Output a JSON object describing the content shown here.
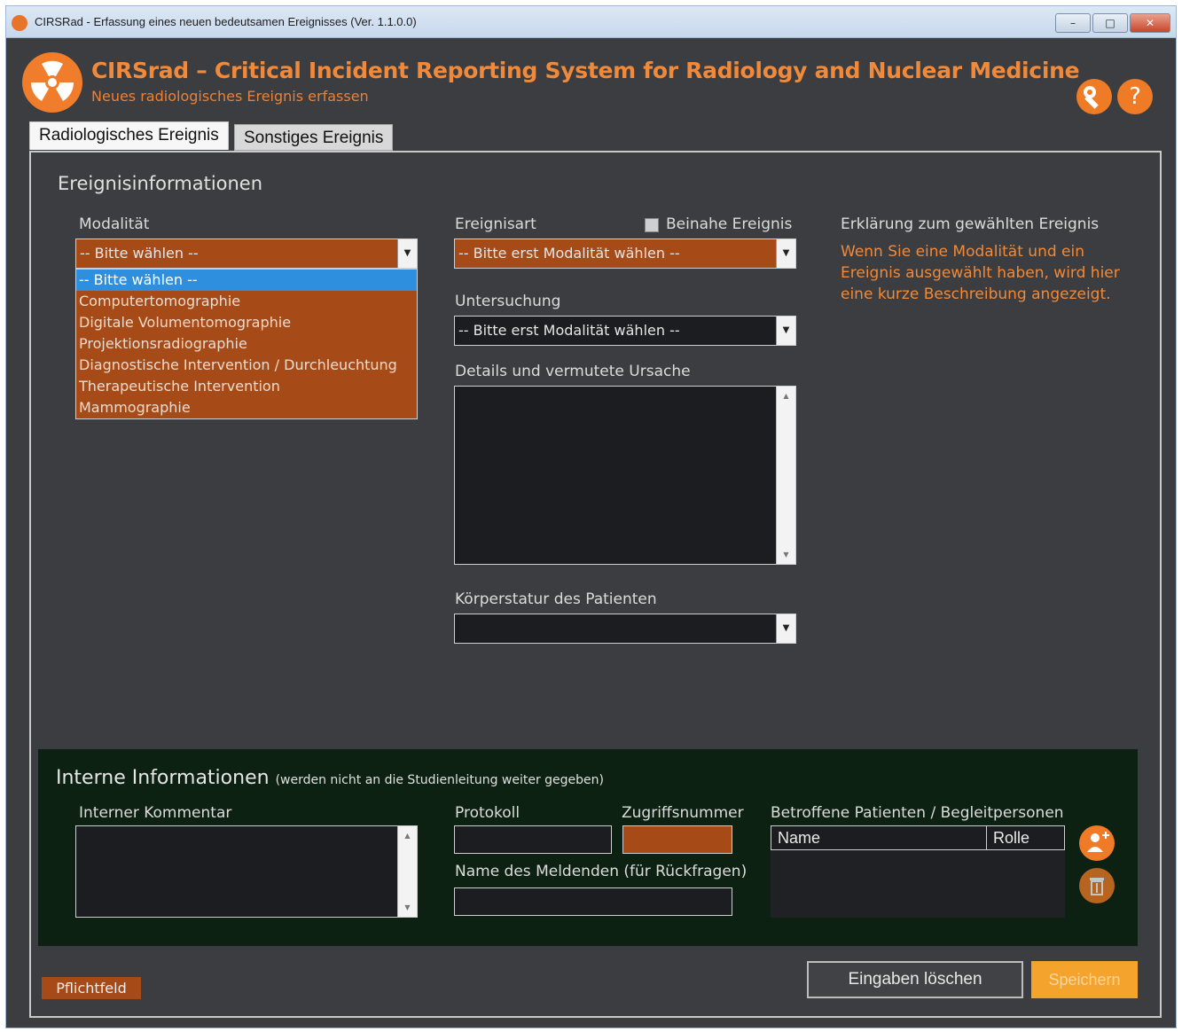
{
  "window": {
    "title": "CIRSRad - Erfassung eines neuen bedeutsamen Ereignisses (Ver. 1.1.0.0)",
    "controls": {
      "minimize": "–",
      "maximize": "□",
      "close": "✕"
    }
  },
  "header": {
    "title": "CIRSrad – Critical Incident Reporting System for Radiology and Nuclear Medicine",
    "subtitle": "Neues radiologisches Ereignis erfassen",
    "help_label": "?"
  },
  "tabs": [
    {
      "label": "Radiologisches Ereignis",
      "active": true
    },
    {
      "label": "Sonstiges Ereignis",
      "active": false
    }
  ],
  "event_info": {
    "section_title": "Ereignisinformationen",
    "modality": {
      "label": "Modalität",
      "value": "-- Bitte wählen --",
      "options": [
        "-- Bitte wählen --",
        "Computertomographie",
        "Digitale Volumentomographie",
        "Projektionsradiographie",
        "Diagnostische Intervention / Durchleuchtung",
        "Therapeutische Intervention",
        "Mammographie"
      ]
    },
    "event_type": {
      "label": "Ereignisart",
      "value": "-- Bitte erst Modalität wählen --"
    },
    "near_miss": {
      "label": "Beinahe Ereignis",
      "checked": false
    },
    "examination": {
      "label": "Untersuchung",
      "value": "-- Bitte erst Modalität wählen --"
    },
    "details": {
      "label": "Details und vermutete Ursache",
      "value": ""
    },
    "body_stature": {
      "label": "Körperstatur des Patienten",
      "value": ""
    },
    "explanation": {
      "label": "Erklärung zum gewählten Ereignis",
      "text": "Wenn Sie eine Modalität und ein Ereignis ausgewählt haben, wird hier eine kurze Beschreibung angezeigt."
    }
  },
  "internal": {
    "title": "Interne Informationen",
    "note": "(werden nicht an die Studienleitung weiter gegeben)",
    "comment": {
      "label": "Interner Kommentar",
      "value": ""
    },
    "protocol": {
      "label": "Protokoll",
      "value": ""
    },
    "access_number": {
      "label": "Zugriffsnummer",
      "value": ""
    },
    "reporter_name": {
      "label": "Name des Meldenden (für Rückfragen)",
      "value": ""
    },
    "affected": {
      "label": "Betroffene Patienten / Begleitpersonen",
      "columns": [
        "Name",
        "Rolle"
      ],
      "rows": []
    }
  },
  "footer": {
    "required_label": "Pflichtfeld",
    "clear_button": "Eingaben löschen",
    "save_button": "Speichern"
  },
  "colors": {
    "accent": "#f07b26",
    "required_field": "#a64b18",
    "background": "#3b3d40",
    "internal_background": "#0d2112",
    "selection": "#2f8fdf"
  }
}
